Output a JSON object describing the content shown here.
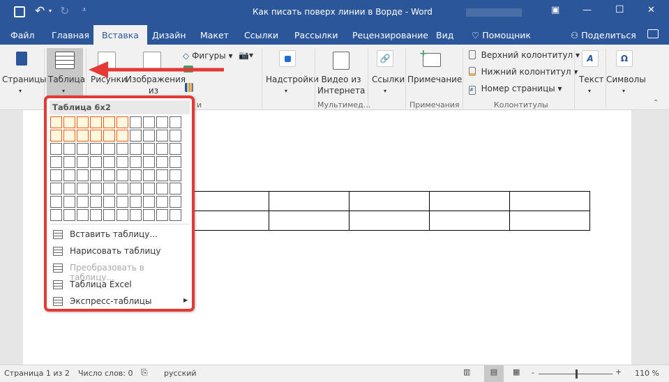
{
  "title": {
    "doc": "Как писать поверх линии в Ворде",
    "sep": "-",
    "app": "Word"
  },
  "qat": {
    "save_icon": "save-icon",
    "undo_icon": "undo-icon",
    "redo_icon": "redo-icon",
    "customize_icon": "customize-icon"
  },
  "window": {
    "ribbon_options": "▣",
    "minimize": "—",
    "maximize": "☐",
    "close": "✕"
  },
  "tabs": [
    "Файл",
    "Главная",
    "Вставка",
    "Дизайн",
    "Макет",
    "Ссылки",
    "Рассылки",
    "Рецензирование",
    "Вид"
  ],
  "active_tab": "Вставка",
  "tell_me": "Помощник",
  "share": "Поделиться",
  "ribbon": {
    "pages": "Страницы",
    "table": "Таблица",
    "pictures": "Рисунки",
    "online_pictures_1": "Изображения",
    "online_pictures_2": "из Интернета",
    "shapes": "Фигуры",
    "addins": "Надстройки",
    "video_1": "Видео из",
    "video_2": "Интернета",
    "links": "Ссылки",
    "comment": "Примечание",
    "header": "Верхний колонтитул",
    "footer": "Нижний колонтитул",
    "page_number": "Номер страницы",
    "text": "Текст",
    "symbols": "Символы",
    "groups": {
      "media": "Мультимед...",
      "comments": "Примечания",
      "header_footer": "Колонтитулы",
      "illustrations_tail": "и"
    }
  },
  "table_menu": {
    "header": "Таблица 6x2",
    "grid_cols": 10,
    "grid_rows": 8,
    "selected_cols": 6,
    "selected_rows": 2,
    "items": [
      {
        "label": "Вставить таблицу...",
        "icon": "table-icon",
        "disabled": false
      },
      {
        "label": "Нарисовать таблицу",
        "icon": "draw-table-icon",
        "disabled": false
      },
      {
        "label": "Преобразовать в таблицу...",
        "icon": "convert-table-icon",
        "disabled": true
      },
      {
        "label": "Таблица Excel",
        "icon": "excel-table-icon",
        "disabled": false
      },
      {
        "label": "Экспресс-таблицы",
        "icon": "quick-tables-icon",
        "disabled": false,
        "submenu": true
      }
    ]
  },
  "document": {
    "table_cols": 6,
    "table_rows": 2
  },
  "status": {
    "page": "Страница 1 из 2",
    "words": "Число слов: 0",
    "language": "русский",
    "zoom": "110 %",
    "zoom_percent": 110
  }
}
